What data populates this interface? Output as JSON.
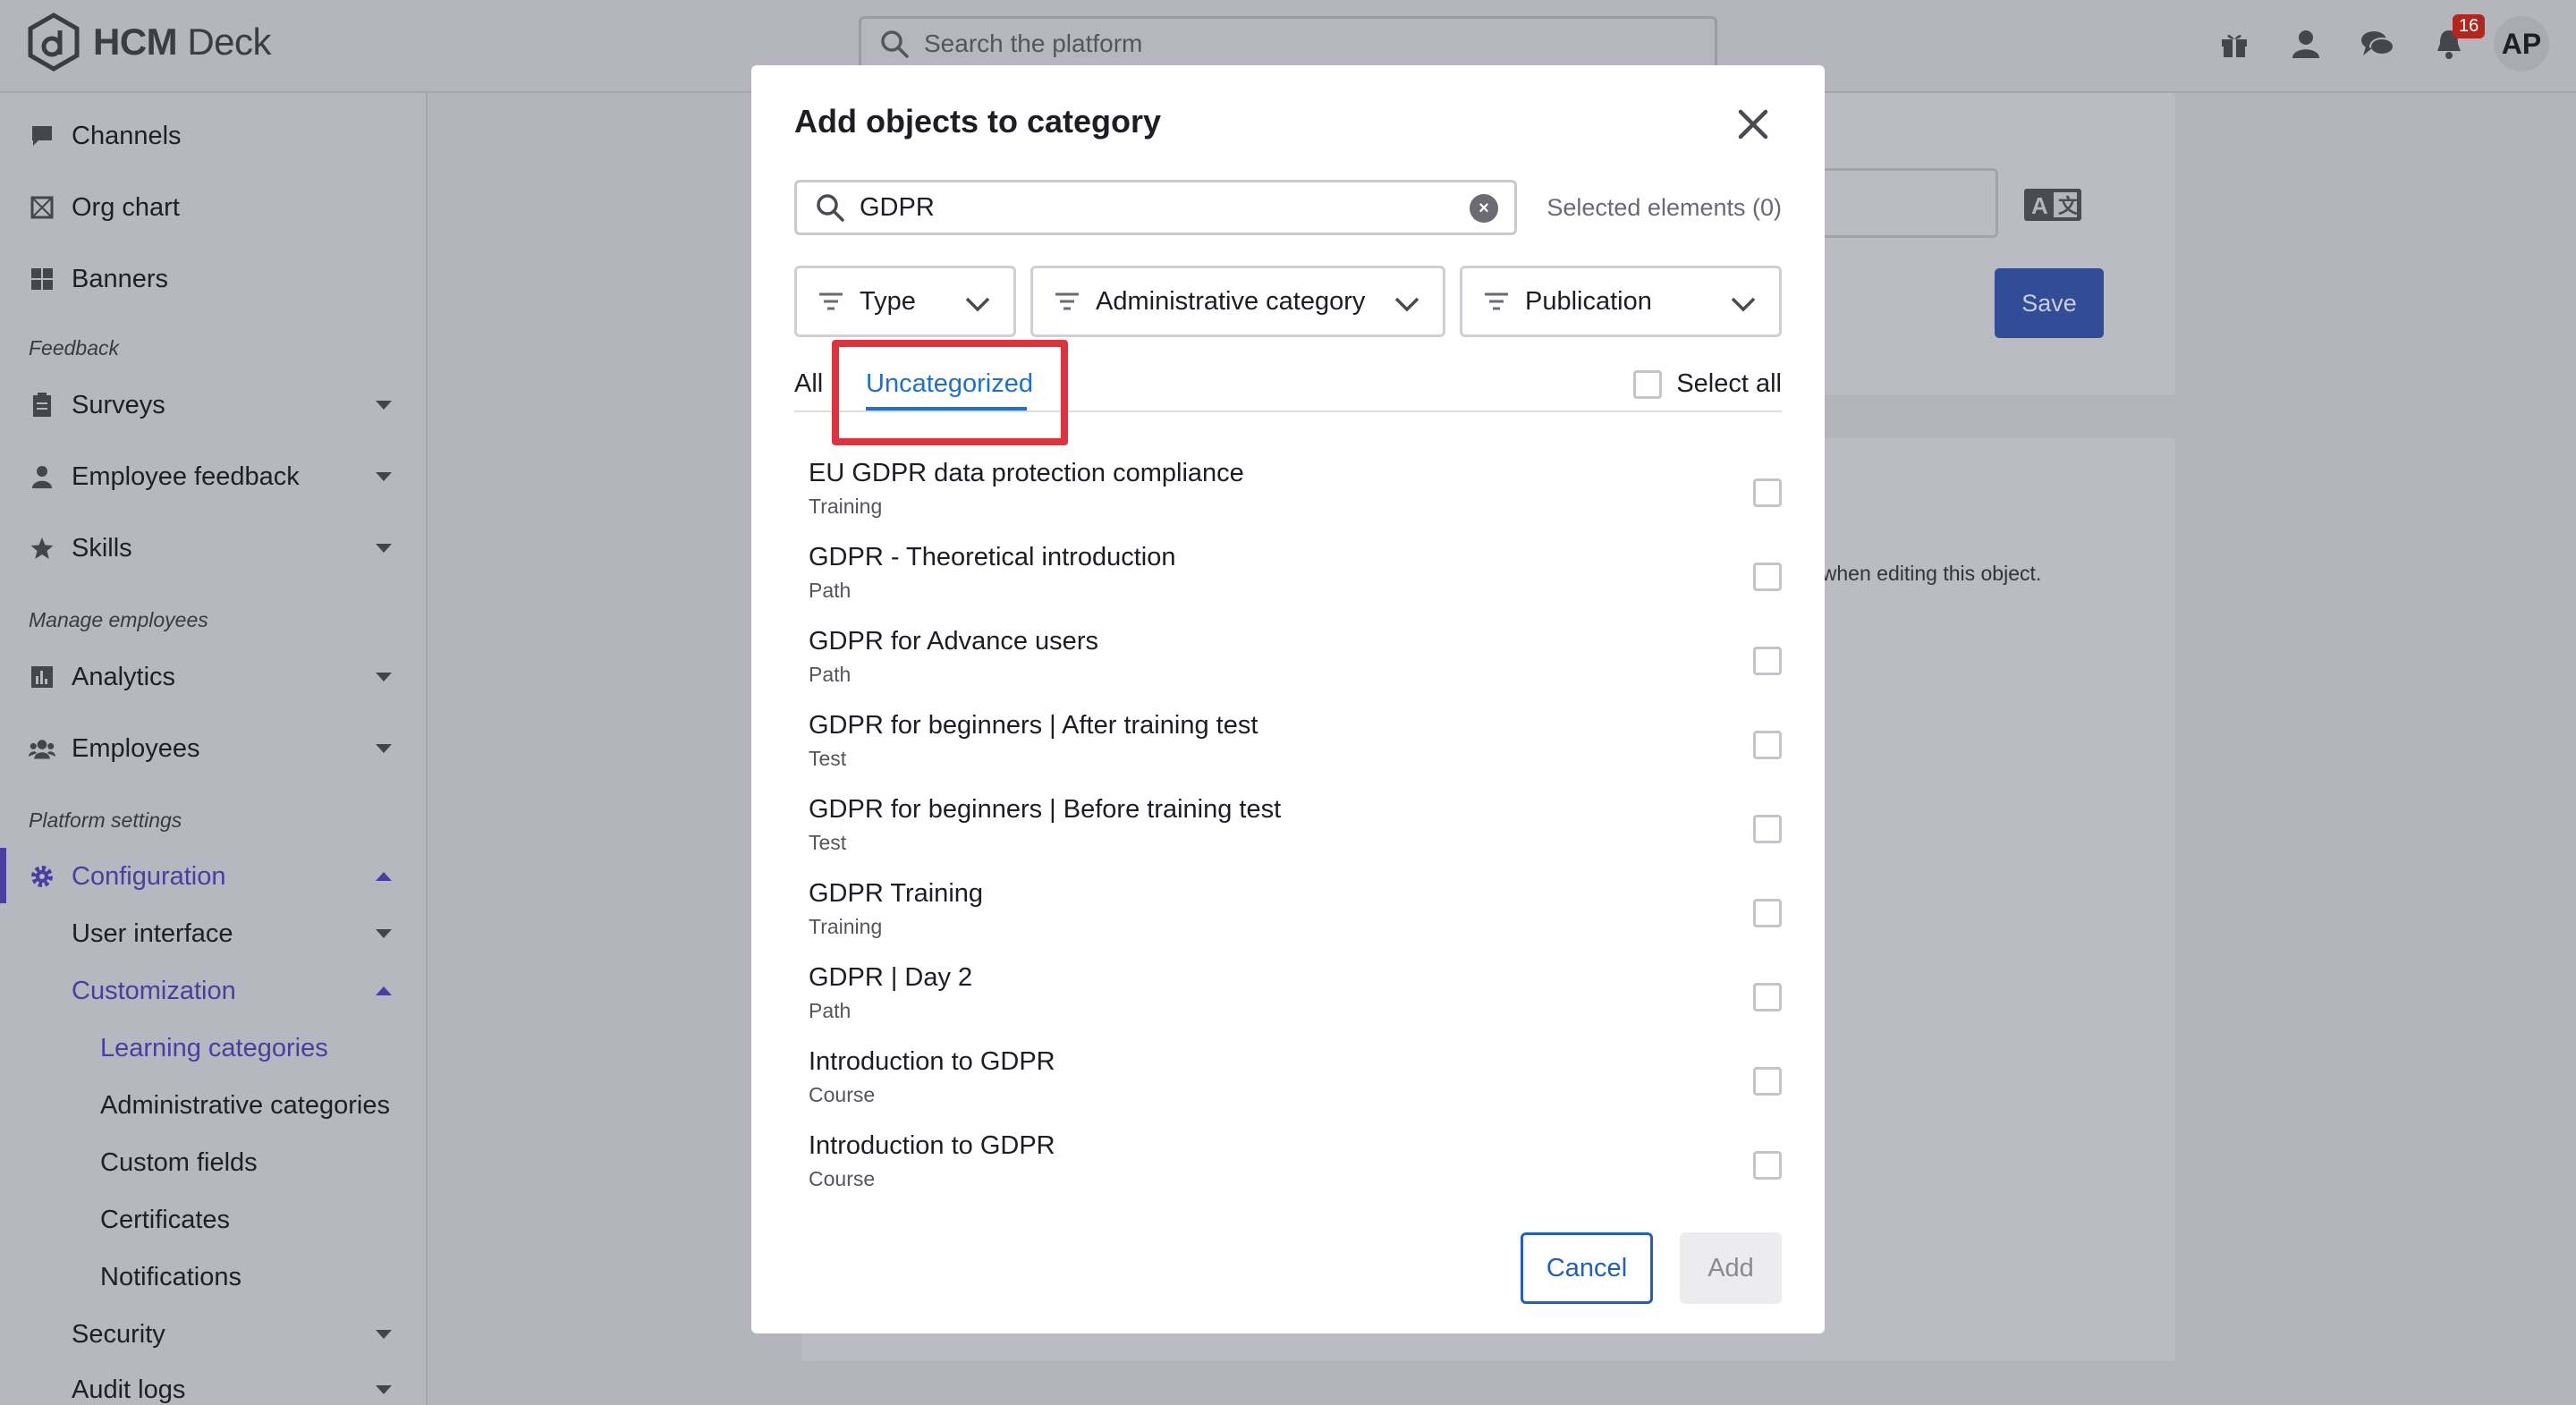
{
  "app": {
    "logo_text_bold": "HCM",
    "logo_text_light": " Deck"
  },
  "topbar": {
    "search_placeholder": "Search the platform",
    "notification_count": "16",
    "avatar_initials": "AP"
  },
  "sidebar": {
    "items": [
      {
        "label": "Channels"
      },
      {
        "label": "Org chart"
      },
      {
        "label": "Banners"
      }
    ],
    "section_feedback": "Feedback",
    "feedback_items": [
      {
        "label": "Surveys"
      },
      {
        "label": "Employee feedback"
      },
      {
        "label": "Skills"
      }
    ],
    "section_manage": "Manage employees",
    "manage_items": [
      {
        "label": "Analytics"
      },
      {
        "label": "Employees"
      }
    ],
    "section_platform": "Platform settings",
    "configuration": "Configuration",
    "user_interface": "User interface",
    "customization": "Customization",
    "customization_items": [
      {
        "label": "Learning categories"
      },
      {
        "label": "Administrative categories"
      },
      {
        "label": "Custom fields"
      },
      {
        "label": "Certificates"
      },
      {
        "label": "Notifications"
      }
    ],
    "security": "Security",
    "audit_logs": "Audit logs"
  },
  "background": {
    "save_label": "Save",
    "note": ": when editing this object."
  },
  "modal": {
    "title": "Add objects to category",
    "search_value": "GDPR",
    "selected_elements": "Selected elements (0)",
    "filters": {
      "type": "Type",
      "admin_category": "Administrative category",
      "publication": "Publication"
    },
    "tabs": {
      "all": "All",
      "uncategorized": "Uncategorized"
    },
    "select_all": "Select all",
    "rows": [
      {
        "title": "EU GDPR data protection compliance",
        "type": "Training"
      },
      {
        "title": "GDPR - Theoretical introduction",
        "type": "Path"
      },
      {
        "title": "GDPR for Advance users",
        "type": "Path"
      },
      {
        "title": "GDPR for beginners | After training test",
        "type": "Test"
      },
      {
        "title": "GDPR for beginners | Before training test",
        "type": "Test"
      },
      {
        "title": "GDPR Training",
        "type": "Training"
      },
      {
        "title": "GDPR | Day 2",
        "type": "Path"
      },
      {
        "title": "Introduction to GDPR",
        "type": "Course"
      },
      {
        "title": "Introduction to GDPR",
        "type": "Course"
      }
    ],
    "cancel_label": "Cancel",
    "add_label": "Add"
  },
  "colors": {
    "accent": "#4a3fa0",
    "link_blue": "#1f6fd1",
    "highlight_red": "#e0313c",
    "save_blue": "#324d97"
  }
}
